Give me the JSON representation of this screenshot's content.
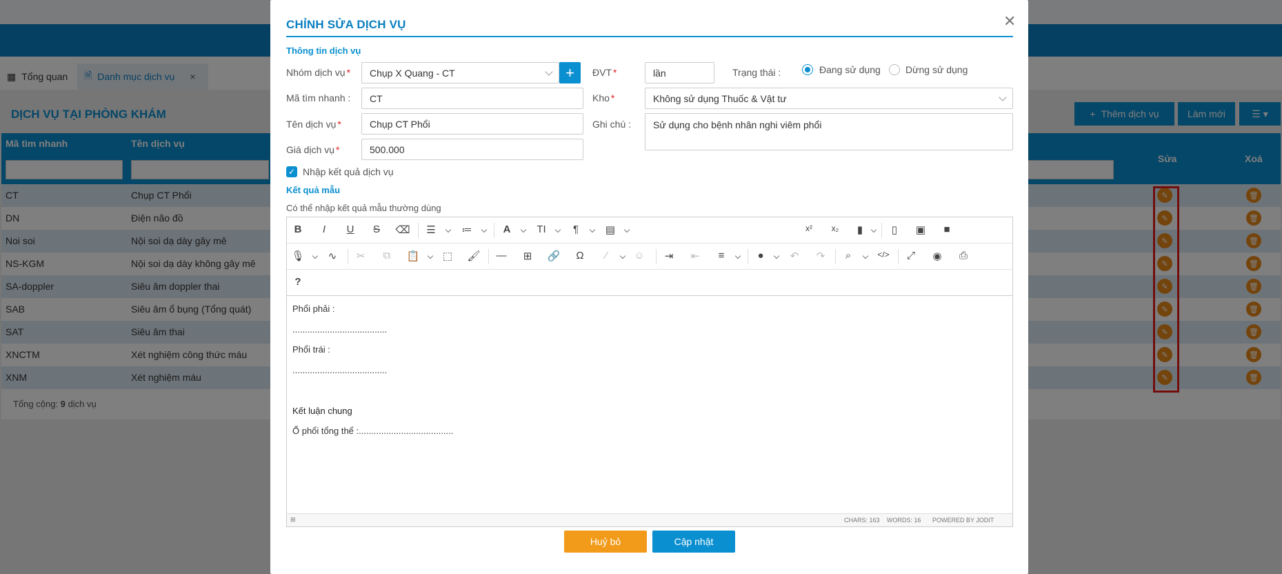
{
  "tabs": [
    {
      "label": "Tổng quan"
    },
    {
      "label": "Danh mục dịch vụ"
    }
  ],
  "page": {
    "title": "DỊCH VỤ TẠI PHÒNG KHÁM",
    "add_button": "Thêm dịch vụ",
    "refresh_button": "Làm mới",
    "columns": {
      "code": "Mã tìm nhanh",
      "name": "Tên dịch vụ",
      "edit": "Sửa",
      "delete": "Xoá"
    },
    "rows": [
      {
        "code": "CT",
        "name": "Chụp CT Phổi"
      },
      {
        "code": "DN",
        "name": "Điện não đồ"
      },
      {
        "code": "Noi soi",
        "name": "Nội soi dạ dày gây mê"
      },
      {
        "code": "NS-KGM",
        "name": "Nội soi dạ dày không gây mê"
      },
      {
        "code": "SA-doppler",
        "name": "Siêu âm doppler thai"
      },
      {
        "code": "SAB",
        "name": "Siêu âm ổ bụng (Tổng quát)"
      },
      {
        "code": "SAT",
        "name": "Siêu âm thai"
      },
      {
        "code": "XNCTM",
        "name": "Xét nghiệm công thức máu"
      },
      {
        "code": "XNM",
        "name": "Xét nghiệm máu"
      }
    ],
    "total_prefix": "Tổng cộng:",
    "total_count": "9",
    "total_suffix": "dịch vụ"
  },
  "modal": {
    "title": "CHỈNH SỬA DỊCH VỤ",
    "section_info": "Thông tin dịch vụ",
    "labels": {
      "group": "Nhóm dịch vụ",
      "unit": "ĐVT",
      "status": "Trạng thái :",
      "code": "Mã tìm nhanh :",
      "warehouse": "Kho",
      "name": "Tên dịch vụ",
      "note": "Ghi chú :",
      "price": "Giá dịch vụ"
    },
    "values": {
      "group": "Chụp X Quang - CT",
      "unit": "lần",
      "code": "CT",
      "warehouse": "Không sử dụng Thuốc & Vật tư",
      "name": "Chụp CT Phổi",
      "note": "Sử dụng cho bệnh nhân nghi viêm phổi",
      "price": "500.000"
    },
    "status_options": {
      "active": "Đang sử dụng",
      "inactive": "Dừng sử dụng"
    },
    "checkbox_label": "Nhập kết quả dịch vụ",
    "section_result": "Kết quả mẫu",
    "result_hint": "Có thể nhập kết quả mẫu thường dùng",
    "editor_lines": [
      "Phổi phải :",
      "......................................",
      "Phổi trái :",
      "......................................",
      "Kết luận chung",
      "Ổ phổi tổng thể :......................................"
    ],
    "editor_status": {
      "chars": "CHARS: 163",
      "words": "WORDS: 16",
      "powered": "POWERED BY JODIT"
    },
    "cancel_button": "Huỷ bỏ",
    "save_button": "Cập nhật"
  },
  "colors": {
    "primary": "#0a8fd0",
    "orange": "#f29b1a",
    "highlight": "#e21b1b"
  }
}
